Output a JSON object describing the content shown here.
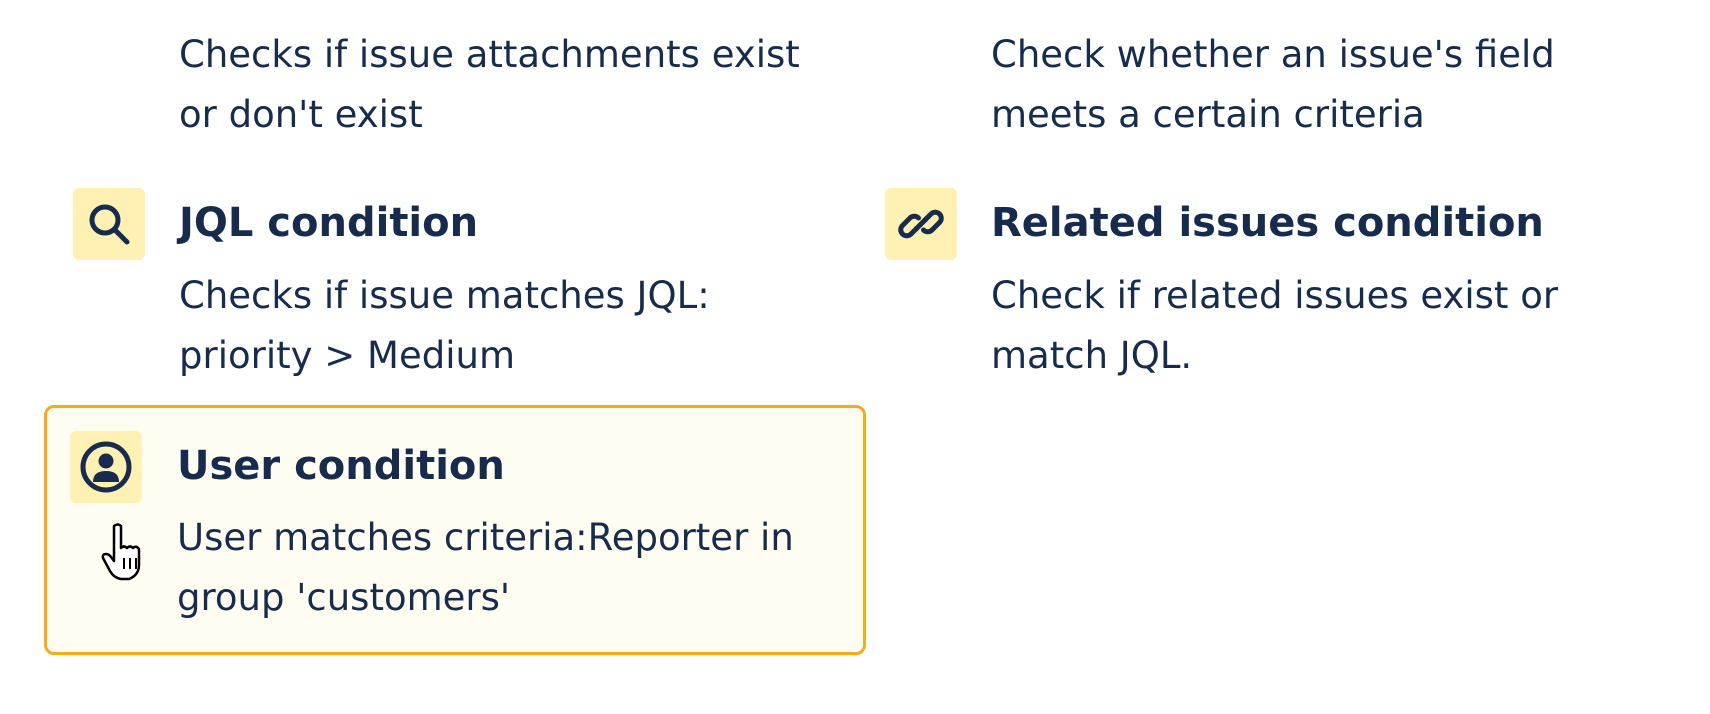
{
  "conditions": [
    {
      "id": "attachments",
      "title": "",
      "description": "Checks if issue attachments exist or don't exist",
      "icon": "attachment-icon"
    },
    {
      "id": "issue-fields",
      "title": "",
      "description": "Check whether an issue's field meets a certain criteria",
      "icon": "field-icon"
    },
    {
      "id": "jql",
      "title": "JQL condition",
      "description": "Checks if issue matches JQL: priority > Medium",
      "icon": "search-icon"
    },
    {
      "id": "related-issues",
      "title": "Related issues condition",
      "description": "Check if related issues exist or match JQL.",
      "icon": "link-icon"
    },
    {
      "id": "user",
      "title": "User condition",
      "description": "User matches criteria:Reporter in group 'customers'",
      "icon": "user-avatar-icon",
      "selected": true
    }
  ],
  "colors": {
    "text": "#172b4d",
    "icon_tile_bg": "#fff0b3",
    "selected_border": "#f5ab1c",
    "selected_bg": "#fffcf2"
  },
  "cursor": "hand-pointer-icon"
}
